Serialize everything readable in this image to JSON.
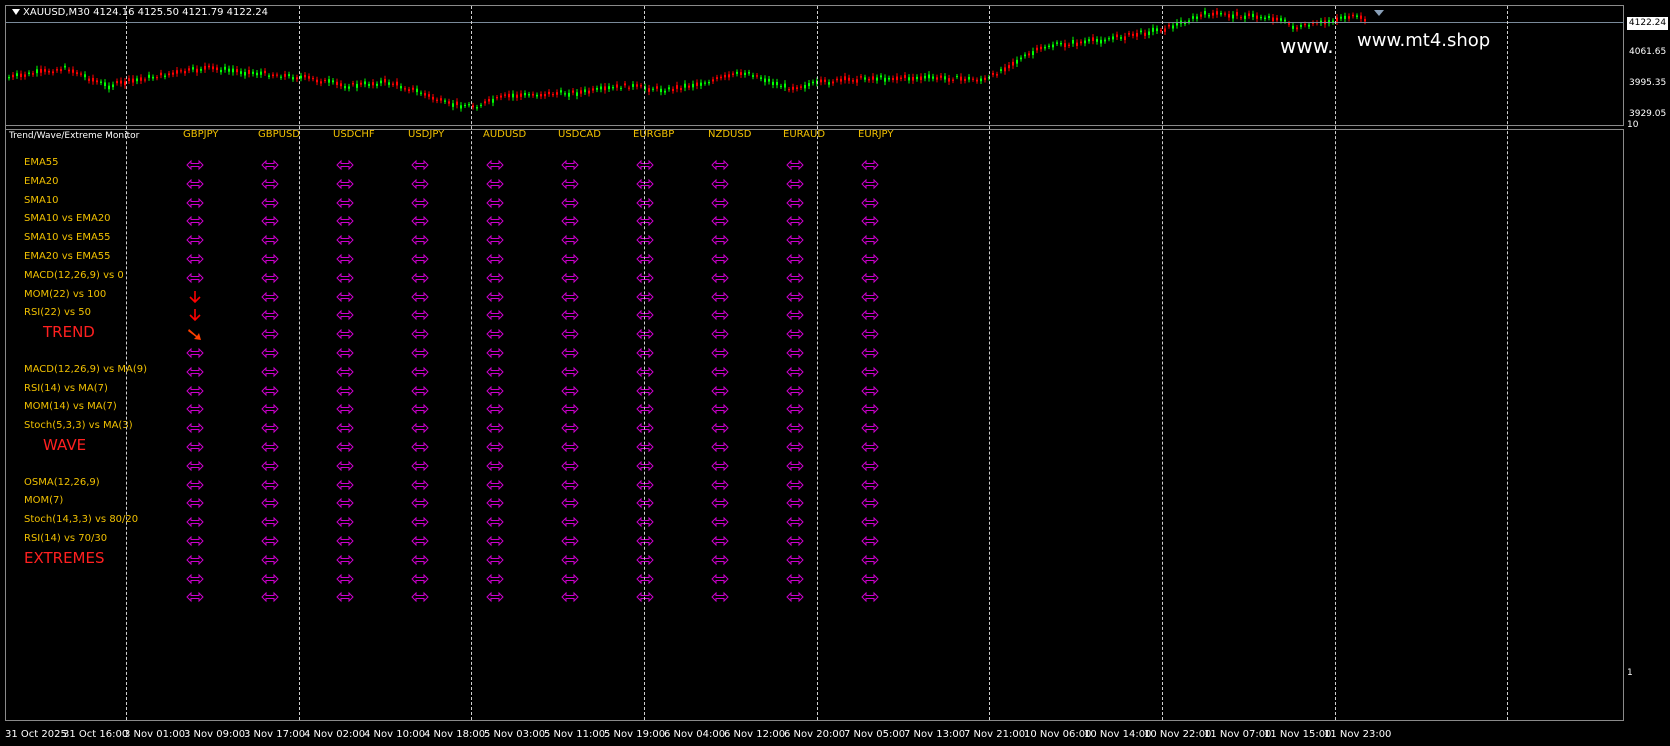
{
  "window": {
    "symbol_header": "XAUUSD,M30  4124.16 4125.50 4121.79 4122.24",
    "indicator_title": "Trend/Wave/Extreme Monitor",
    "watermark_left": "www.",
    "watermark_right": "www.mt4.shop"
  },
  "price_axis": {
    "current_price": "4122.24",
    "ticks": [
      "4061.65",
      "3995.35",
      "3929.05"
    ],
    "indicator_ticks": [
      "10",
      "1"
    ]
  },
  "time_axis": {
    "labels": [
      "31 Oct 2025",
      "31 Oct 16:00",
      "3 Nov 01:00",
      "3 Nov 09:00",
      "3 Nov 17:00",
      "4 Nov 02:00",
      "4 Nov 10:00",
      "4 Nov 18:00",
      "5 Nov 03:00",
      "5 Nov 11:00",
      "5 Nov 19:00",
      "6 Nov 04:00",
      "6 Nov 12:00",
      "6 Nov 20:00",
      "7 Nov 05:00",
      "7 Nov 13:00",
      "7 Nov 21:00",
      "10 Nov 06:00",
      "10 Nov 14:00",
      "10 Nov 22:00",
      "11 Nov 07:00",
      "11 Nov 15:00",
      "11 Nov 23:00"
    ]
  },
  "monitor": {
    "pairs": [
      "GBPJPY",
      "GBPUSD",
      "USDCHF",
      "USDJPY",
      "AUDUSD",
      "USDCAD",
      "EURGBP",
      "NZDUSD",
      "EURAUD",
      "EURJPY"
    ],
    "rows": [
      {
        "label": "EMA55",
        "type": "row"
      },
      {
        "label": "EMA20",
        "type": "row"
      },
      {
        "label": "SMA10",
        "type": "row"
      },
      {
        "label": "SMA10 vs EMA20",
        "type": "row"
      },
      {
        "label": "SMA10 vs EMA55",
        "type": "row"
      },
      {
        "label": "EMA20 vs EMA55",
        "type": "row"
      },
      {
        "label": "MACD(12,26,9) vs 0",
        "type": "row"
      },
      {
        "label": "MOM(22) vs 100",
        "type": "row"
      },
      {
        "label": "RSI(22) vs 50",
        "type": "row"
      },
      {
        "label": "TREND",
        "type": "section"
      },
      {
        "label": "",
        "type": "blank"
      },
      {
        "label": "MACD(12,26,9) vs MA(9)",
        "type": "row"
      },
      {
        "label": "RSI(14) vs MA(7)",
        "type": "row"
      },
      {
        "label": "MOM(14) vs MA(7)",
        "type": "row"
      },
      {
        "label": "Stoch(5,3,3) vs MA(3)",
        "type": "row"
      },
      {
        "label": "WAVE",
        "type": "section"
      },
      {
        "label": "",
        "type": "blank"
      },
      {
        "label": "OSMA(12,26,9)",
        "type": "row"
      },
      {
        "label": "MOM(7)",
        "type": "row"
      },
      {
        "label": "Stoch(14,3,3) vs 80/20",
        "type": "row"
      },
      {
        "label": "RSI(14) vs 70/30",
        "type": "row"
      },
      {
        "label": "EXTREMES",
        "type": "section"
      },
      {
        "label": "",
        "type": "blank"
      },
      {
        "label": "",
        "type": "blank"
      }
    ],
    "signal_overrides": [
      {
        "row": 7,
        "col": 0,
        "signal": "down"
      },
      {
        "row": 8,
        "col": 0,
        "signal": "down"
      },
      {
        "row": 9,
        "col": 0,
        "signal": "down-right"
      }
    ],
    "default_signal": "neutral"
  },
  "colors": {
    "up_candle": "#00ff00",
    "down_candle": "#ff0000",
    "label_yellow": "#f0c000",
    "section_red": "#ff2020",
    "neutral_arrow": "#cc00cc",
    "down_arrow": "#ff0000",
    "trend_arrow": "#ff4000"
  }
}
